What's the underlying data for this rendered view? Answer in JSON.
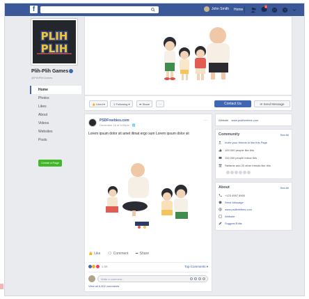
{
  "topbar": {
    "user_name": "John Smith",
    "home_label": "Home",
    "badge_count": "3"
  },
  "profile": {
    "logo_line1": "PLIH",
    "logo_line2": "PLIH",
    "page_name": "Plih-Plih Games",
    "handle": "@PlihPlihGames"
  },
  "leftnav": {
    "items": [
      "Home",
      "Photos",
      "Likes",
      "About",
      "Videos",
      "Websites",
      "Posts"
    ],
    "create_button": "Create a Page"
  },
  "actionbar": {
    "liked": "Liked",
    "following": "Following",
    "share": "Share",
    "more": "···",
    "contact": "Contact Us",
    "send": "Send Message"
  },
  "post": {
    "author": "PSDFreebies.com",
    "time": "December 16 at 6:00pm · ",
    "more": "···",
    "text": "Lorem ipsum dolor sit amet illmat ergo sum Lorem ipsum dolor sit",
    "like": "Like",
    "comment": "Comment",
    "share": "Share",
    "reaction_count": "1.5K",
    "top_comments": "Top Comments",
    "comment_placeholder": "Write a comment...",
    "view_comments": "View all 6,302 comments"
  },
  "website_card": {
    "label": "Website",
    "url": "www.psdfreebies.com"
  },
  "community": {
    "title": "Community",
    "see_all": "See All",
    "rows": [
      "Invite your friends to like this Page",
      "100,000 people like this",
      "110,000 people follow this",
      "Stefanie and 20 other friends like this"
    ]
  },
  "about": {
    "title": "About",
    "see_all": "See All",
    "rows": [
      "+123 4567 8900",
      "Send Message",
      "www.psdfreebies.com",
      "Website",
      "Suggest Edits"
    ]
  },
  "colors": {
    "brand": "#3b5998",
    "accent": "#4267b2",
    "green": "#42b72a"
  }
}
